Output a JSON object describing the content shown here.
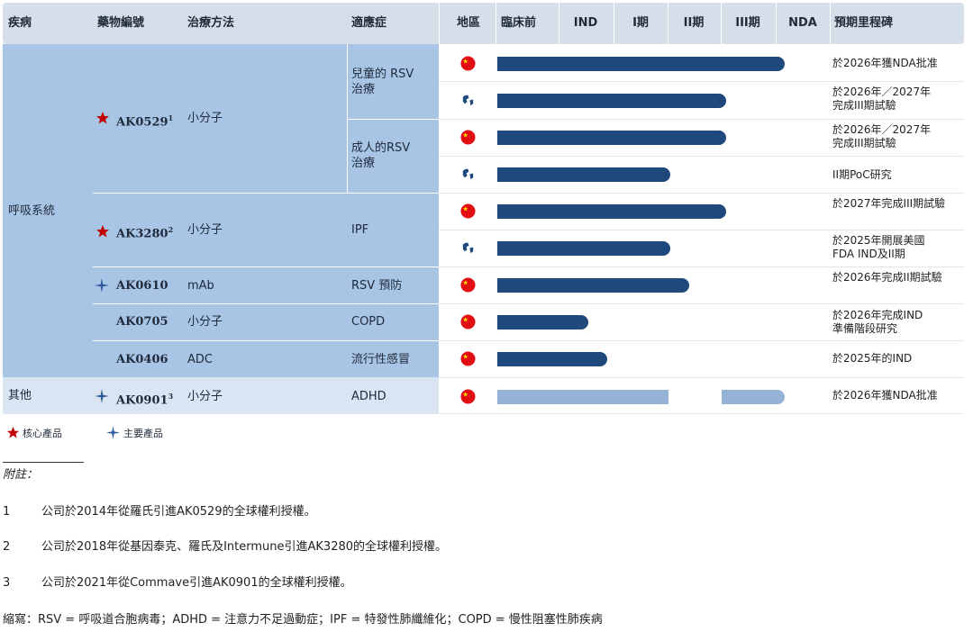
{
  "header": {
    "disease": "疾病",
    "drug": "藥物編號",
    "method": "治療方法",
    "indication": "適應症",
    "region": "地區",
    "preclinical": "臨床前",
    "ind": "IND",
    "phase1": "I期",
    "phase2": "II期",
    "phase3": "III期",
    "nda": "NDA",
    "milestone": "預期里程碑"
  },
  "groups": {
    "respiratory": "呼吸系統",
    "other": "其他"
  },
  "drugs": {
    "d1": {
      "name": "AK0529",
      "sup": "1",
      "method": "小分子",
      "icon": "star-core"
    },
    "d2": {
      "name": "AK3280",
      "sup": "2",
      "method": "小分子",
      "icon": "star-key"
    },
    "d3": {
      "name": "AK0610",
      "method": "mAb",
      "indication": "RSV 預防",
      "icon": "cross-star"
    },
    "d4": {
      "name": "AK0705",
      "method": "小分子",
      "indication": "COPD"
    },
    "d5": {
      "name": "AK0406",
      "method": "ADC",
      "indication": "流行性感冒"
    },
    "d6": {
      "name": "AK0901",
      "sup": "3",
      "method": "小分子",
      "indication": "ADHD",
      "icon": "cross-star"
    }
  },
  "indications": {
    "children_rsv": [
      "兒童的 RSV",
      "治療"
    ],
    "adult_rsv": [
      "成人的RSV",
      "治療"
    ],
    "ipf": "IPF"
  },
  "rows": [
    {
      "region": "china-flag",
      "stage_end": "NDA",
      "milestone": [
        "於2026年獲NDA批准"
      ]
    },
    {
      "region": "globe-icon",
      "stage_end": "III期",
      "milestone": [
        "於2026年／2027年",
        "完成III期試驗"
      ]
    },
    {
      "region": "china-flag",
      "stage_end": "III期",
      "milestone": [
        "於2026年／2027年",
        "完成III期試驗"
      ]
    },
    {
      "region": "globe-icon",
      "stage_end": "II期",
      "milestone": [
        "II期PoC研究"
      ]
    },
    {
      "region": "china-flag",
      "stage_end": "III期",
      "milestone": [
        "於2027年完成III期試驗"
      ]
    },
    {
      "region": "globe-icon",
      "stage_end": "II期",
      "milestone": [
        "於2025年開展美國",
        "FDA IND及II期"
      ]
    },
    {
      "region": "china-flag",
      "stage_end": "II期",
      "milestone": [
        "於2026年完成II期試驗"
      ]
    },
    {
      "region": "china-flag",
      "stage_end": "IND",
      "milestone": [
        "於2026年完成IND",
        "準備階段研究"
      ]
    },
    {
      "region": "china-flag",
      "stage_end": "IND",
      "milestone": [
        "於2025年的IND"
      ]
    },
    {
      "region": "china-flag",
      "stage_end": "NDA",
      "milestone": [
        "於2026年獲NDA批准"
      ]
    }
  ],
  "legend": {
    "core": "核心產品",
    "key": "主要產品"
  },
  "notes": {
    "title": "附註：",
    "items": [
      {
        "num": "1",
        "text": "公司於2014年從羅氏引進AK0529的全球權利授權。"
      },
      {
        "num": "2",
        "text": "公司於2018年從基因泰克、羅氏及Intermune引進AK3280的全球權利授權。"
      },
      {
        "num": "3",
        "text": "公司於2021年從Commave引進AK0901的全球權利授權。"
      }
    ],
    "abbrev": "縮寫：RSV = 呼吸道合胞病毒；ADHD = 注意力不足過動症；IPF = 特發性肺纖維化；COPD = 慢性阻塞性肺疾病"
  },
  "colors": {
    "bar_dark": "#1f497d",
    "bar_light": "#95b3d7",
    "group_bg": "#a8c5e6",
    "other_bg": "#d9e5f2",
    "header_bg": "#d6dfe9",
    "core_star": "#c00000",
    "key_star": "#2e5c9a"
  }
}
